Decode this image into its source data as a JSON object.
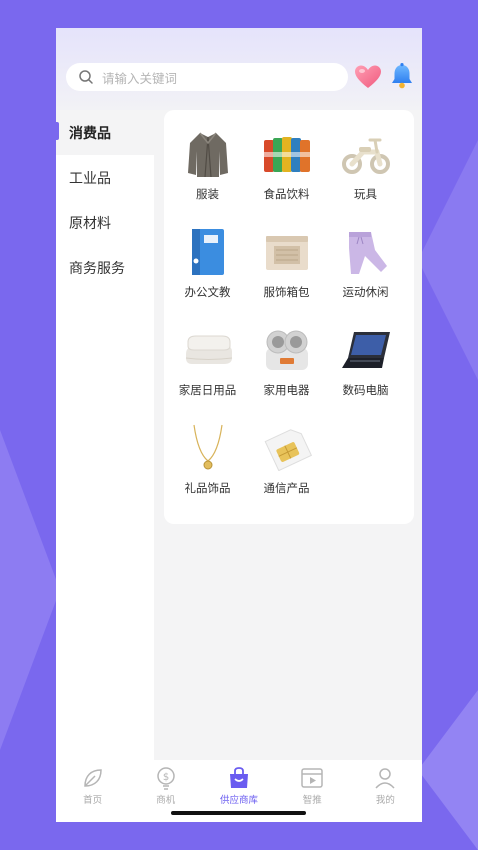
{
  "search": {
    "placeholder": "请输入关键词"
  },
  "sidebar": {
    "items": [
      {
        "label": "消费品",
        "active": true
      },
      {
        "label": "工业品"
      },
      {
        "label": "原材料"
      },
      {
        "label": "商务服务"
      }
    ]
  },
  "categories": [
    {
      "label": "服装",
      "icon": "coat-image"
    },
    {
      "label": "食品饮料",
      "icon": "snack-bags-image"
    },
    {
      "label": "玩具",
      "icon": "balance-bike-image"
    },
    {
      "label": "办公文教",
      "icon": "binder-image"
    },
    {
      "label": "服饰箱包",
      "icon": "storage-box-image"
    },
    {
      "label": "运动休闲",
      "icon": "sweatpants-image"
    },
    {
      "label": "家居日用品",
      "icon": "pillows-image"
    },
    {
      "label": "家用电器",
      "icon": "cooker-image"
    },
    {
      "label": "数码电脑",
      "icon": "laptop-image"
    },
    {
      "label": "礼品饰品",
      "icon": "necklace-image"
    },
    {
      "label": "通信产品",
      "icon": "sim-card-image"
    }
  ],
  "tabs": [
    {
      "label": "首页",
      "icon": "leaf-icon"
    },
    {
      "label": "商机",
      "icon": "coin-bulb-icon"
    },
    {
      "label": "供应商库",
      "icon": "shop-bag-icon",
      "active": true
    },
    {
      "label": "智推",
      "icon": "video-icon"
    },
    {
      "label": "我的",
      "icon": "person-icon"
    }
  ],
  "colors": {
    "accent": "#7a68ee",
    "active_tab": "#6a5cf0"
  }
}
